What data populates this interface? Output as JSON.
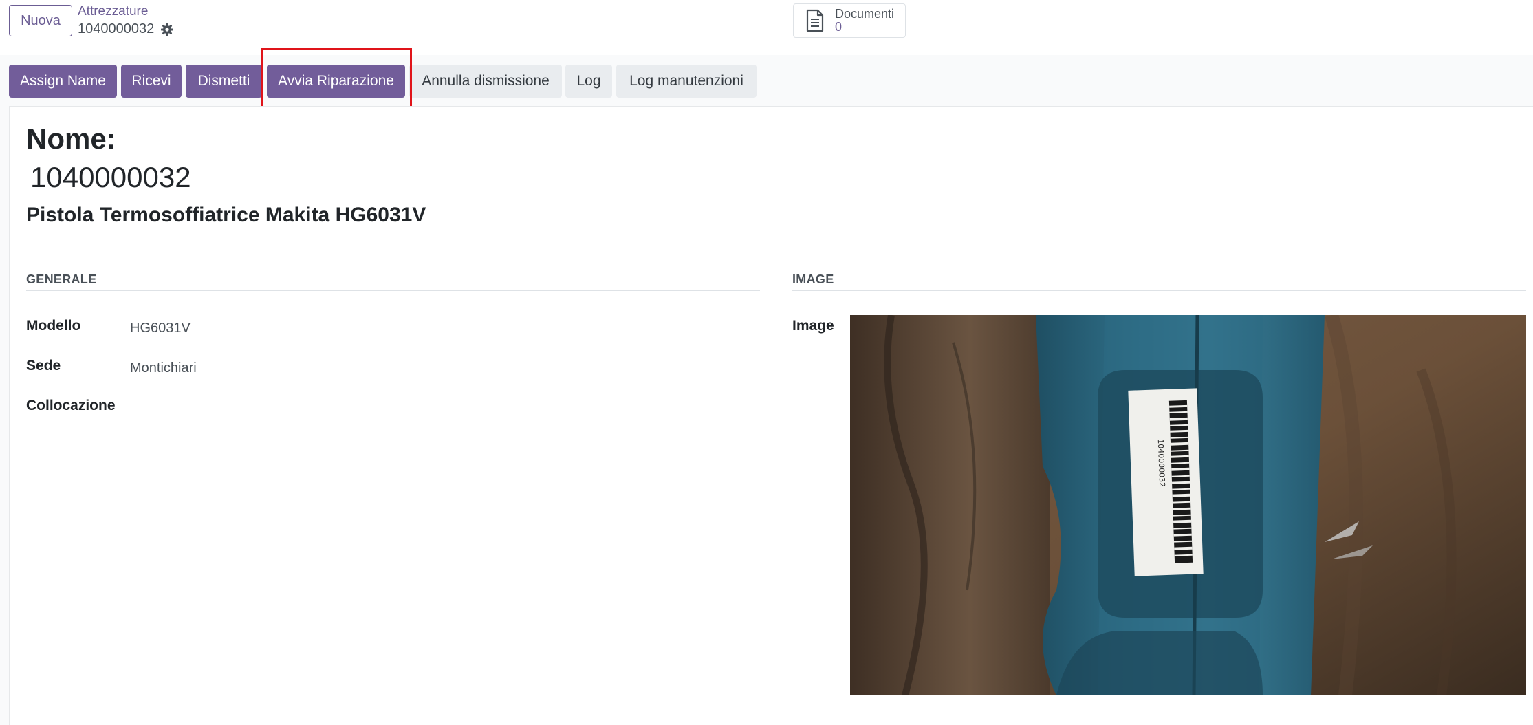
{
  "header": {
    "new_button": "Nuova",
    "breadcrumb_parent": "Attrezzature",
    "breadcrumb_current": "1040000032",
    "smart_button": {
      "label": "Documenti",
      "value": "0",
      "icon": "document-icon"
    },
    "settings_icon": "gear-icon"
  },
  "statusbar": {
    "buttons": [
      {
        "label": "Assign Name",
        "style": "primary"
      },
      {
        "label": "Ricevi",
        "style": "primary"
      },
      {
        "label": "Dismetti",
        "style": "primary"
      },
      {
        "label": "Avvia Riparazione",
        "style": "primary",
        "highlighted": true
      },
      {
        "label": "Annulla dismissione",
        "style": "secondary"
      },
      {
        "label": "Log",
        "style": "secondary"
      },
      {
        "label": "Log manutenzioni",
        "style": "secondary"
      }
    ]
  },
  "form": {
    "name_label": "Nome:",
    "name_value": "1040000032",
    "description": "Pistola Termosoffiatrice Makita HG6031V",
    "groups": {
      "general_title": "GENERALE",
      "image_title": "IMAGE"
    },
    "fields": [
      {
        "label": "Modello",
        "value": "HG6031V"
      },
      {
        "label": "Sede",
        "value": "Montichiari"
      },
      {
        "label": "Collocazione",
        "value": ""
      }
    ],
    "image_label": "Image",
    "image_barcode_text": "1040000032"
  },
  "colors": {
    "primary": "#725d9a",
    "link": "#6b5d94",
    "secondary": "#e9ecef",
    "highlight_box": "#e0141a"
  }
}
